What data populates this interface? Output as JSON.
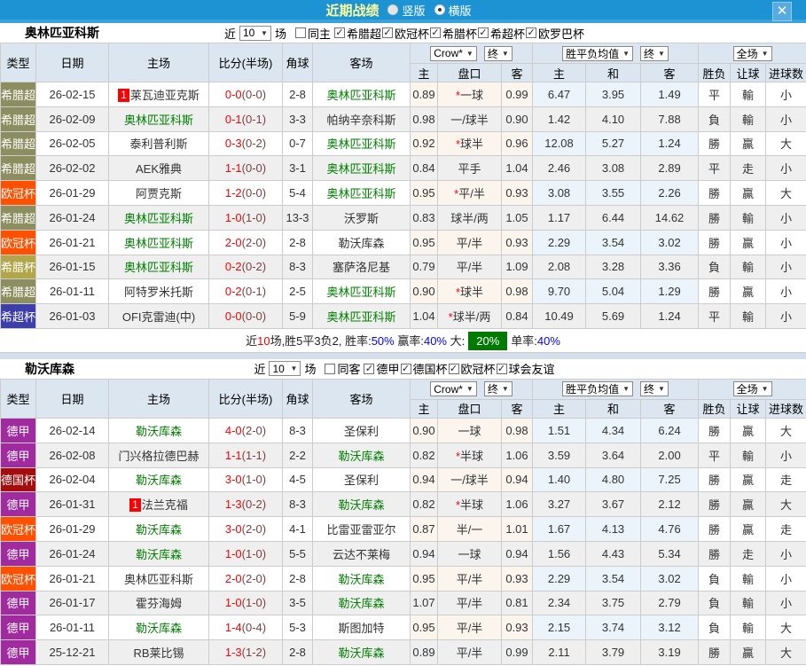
{
  "topbar": {
    "title": "近期战绩",
    "vertical_label": "竖版",
    "horizontal_label": "横版",
    "close_glyph": "✕"
  },
  "filter_labels": {
    "near": "近",
    "games": "场"
  },
  "table_header": {
    "type": "类型",
    "date": "日期",
    "home": "主场",
    "score": "比分(半场)",
    "corner": "角球",
    "away": "客场",
    "company": "Crow*",
    "final": "终",
    "avg": "胜平负均值",
    "full": "全场",
    "h_home": "主",
    "h_handicap": "盘口",
    "h_away": "客",
    "h_draw": "和",
    "h_wdl": "胜负",
    "h_handicap_result": "让球",
    "h_goals": "进球数"
  },
  "type_colors": {
    "希腊超": "#8d8e5f",
    "欧冠杯": "#ff5000",
    "希腊杯": "#b2a64a",
    "希超杯": "#3e3eaa",
    "德甲": "#9f2b9f",
    "德国杯": "#a30d0d"
  },
  "sections": [
    {
      "team": "奥林匹亚科斯",
      "filter": {
        "count": "10",
        "same_label": "同主",
        "same_checked": false,
        "leagues": [
          "希腊超",
          "欧冠杯",
          "希腊杯",
          "希超杯",
          "欧罗巴杯"
        ]
      },
      "rows": [
        {
          "type": "希腊超",
          "date": "26-02-15",
          "badge": "1",
          "home": "莱瓦迪亚克斯",
          "hg": false,
          "score": "0-0",
          "half": "0-0",
          "corner": "2-8",
          "away": "奥林匹亚科斯",
          "ag": true,
          "odds": [
            "0.89",
            "0.99"
          ],
          "star": true,
          "handicap": "一球",
          "avg": [
            "6.47",
            "3.95",
            "1.49"
          ],
          "results": [
            "平",
            "輸",
            "小"
          ]
        },
        {
          "type": "希腊超",
          "date": "26-02-09",
          "badge": "",
          "home": "奥林匹亚科斯",
          "hg": true,
          "score": "0-1",
          "half": "0-1",
          "corner": "3-3",
          "away": "帕纳辛奈科斯",
          "ag": false,
          "odds": [
            "0.98",
            "0.90"
          ],
          "star": false,
          "handicap": "一/球半",
          "avg": [
            "1.42",
            "4.10",
            "7.88"
          ],
          "results": [
            "負",
            "輸",
            "小"
          ]
        },
        {
          "type": "希腊超",
          "date": "26-02-05",
          "badge": "",
          "home": "泰利普利斯",
          "hg": false,
          "score": "0-3",
          "half": "0-2",
          "corner": "0-7",
          "away": "奥林匹亚科斯",
          "ag": true,
          "odds": [
            "0.92",
            "0.96"
          ],
          "star": true,
          "handicap": "球半",
          "avg": [
            "12.08",
            "5.27",
            "1.24"
          ],
          "results": [
            "勝",
            "贏",
            "大"
          ]
        },
        {
          "type": "希腊超",
          "date": "26-02-02",
          "badge": "",
          "home": "AEK雅典",
          "hg": false,
          "score": "1-1",
          "half": "0-0",
          "corner": "3-1",
          "away": "奥林匹亚科斯",
          "ag": true,
          "odds": [
            "0.84",
            "1.04"
          ],
          "star": false,
          "handicap": "平手",
          "avg": [
            "2.46",
            "3.08",
            "2.89"
          ],
          "results": [
            "平",
            "走",
            "小"
          ]
        },
        {
          "type": "欧冠杯",
          "date": "26-01-29",
          "badge": "",
          "home": "阿贾克斯",
          "hg": false,
          "score": "1-2",
          "half": "0-0",
          "corner": "5-4",
          "away": "奥林匹亚科斯",
          "ag": true,
          "odds": [
            "0.95",
            "0.93"
          ],
          "star": true,
          "handicap": "平/半",
          "avg": [
            "3.08",
            "3.55",
            "2.26"
          ],
          "results": [
            "勝",
            "贏",
            "大"
          ]
        },
        {
          "type": "希腊超",
          "date": "26-01-24",
          "badge": "",
          "home": "奥林匹亚科斯",
          "hg": true,
          "score": "1-0",
          "half": "1-0",
          "corner": "13-3",
          "away": "沃罗斯",
          "ag": false,
          "odds": [
            "0.83",
            "1.05"
          ],
          "star": false,
          "handicap": "球半/两",
          "avg": [
            "1.17",
            "6.44",
            "14.62"
          ],
          "results": [
            "勝",
            "輸",
            "小"
          ]
        },
        {
          "type": "欧冠杯",
          "date": "26-01-21",
          "badge": "",
          "home": "奥林匹亚科斯",
          "hg": true,
          "score": "2-0",
          "half": "2-0",
          "corner": "2-8",
          "away": "勒沃库森",
          "ag": false,
          "odds": [
            "0.95",
            "0.93"
          ],
          "star": false,
          "handicap": "平/半",
          "avg": [
            "2.29",
            "3.54",
            "3.02"
          ],
          "results": [
            "勝",
            "贏",
            "小"
          ]
        },
        {
          "type": "希腊杯",
          "date": "26-01-15",
          "badge": "",
          "home": "奥林匹亚科斯",
          "hg": true,
          "score": "0-2",
          "half": "0-2",
          "corner": "8-3",
          "away": "塞萨洛尼基",
          "ag": false,
          "odds": [
            "0.79",
            "1.09"
          ],
          "star": false,
          "handicap": "平/半",
          "avg": [
            "2.08",
            "3.28",
            "3.36"
          ],
          "results": [
            "負",
            "輸",
            "小"
          ]
        },
        {
          "type": "希腊超",
          "date": "26-01-11",
          "badge": "",
          "home": "阿特罗米托斯",
          "hg": false,
          "score": "0-2",
          "half": "0-1",
          "corner": "2-5",
          "away": "奥林匹亚科斯",
          "ag": true,
          "odds": [
            "0.90",
            "0.98"
          ],
          "star": true,
          "handicap": "球半",
          "avg": [
            "9.70",
            "5.04",
            "1.29"
          ],
          "results": [
            "勝",
            "贏",
            "小"
          ]
        },
        {
          "type": "希超杯",
          "date": "26-01-03",
          "badge": "",
          "home": "OFI克雷迪(中)",
          "hg": false,
          "score": "0-0",
          "half": "0-0",
          "corner": "5-9",
          "away": "奥林匹亚科斯",
          "ag": true,
          "odds": [
            "1.04",
            "0.84"
          ],
          "star": true,
          "handicap": "球半/两",
          "avg": [
            "10.49",
            "5.69",
            "1.24"
          ],
          "results": [
            "平",
            "輸",
            "小"
          ]
        }
      ],
      "summary": [
        {
          "t": "近",
          "c": "k"
        },
        {
          "t": "10",
          "c": "r"
        },
        {
          "t": "场,胜5平3负2, 胜率:",
          "c": "k"
        },
        {
          "t": "50%",
          "c": "b"
        },
        {
          "t": " 赢率:",
          "c": "k"
        },
        {
          "t": "40%",
          "c": "b"
        },
        {
          "t": " 大:",
          "c": "k"
        },
        {
          "t": "20%",
          "c": "badge"
        },
        {
          "t": "单率:",
          "c": "k"
        },
        {
          "t": "40%",
          "c": "b"
        }
      ]
    },
    {
      "team": "勒沃库森",
      "filter": {
        "count": "10",
        "same_label": "同客",
        "same_checked": false,
        "leagues": [
          "德甲",
          "德国杯",
          "欧冠杯",
          "球会友谊"
        ]
      },
      "rows": [
        {
          "type": "德甲",
          "date": "26-02-14",
          "badge": "",
          "home": "勒沃库森",
          "hg": true,
          "score": "4-0",
          "half": "2-0",
          "corner": "8-3",
          "away": "圣保利",
          "ag": false,
          "odds": [
            "0.90",
            "0.98"
          ],
          "star": false,
          "handicap": "一球",
          "avg": [
            "1.51",
            "4.34",
            "6.24"
          ],
          "results": [
            "勝",
            "贏",
            "大"
          ]
        },
        {
          "type": "德甲",
          "date": "26-02-08",
          "badge": "",
          "home": "门兴格拉德巴赫",
          "hg": false,
          "score": "1-1",
          "half": "1-1",
          "corner": "2-2",
          "away": "勒沃库森",
          "ag": true,
          "odds": [
            "0.82",
            "1.06"
          ],
          "star": true,
          "handicap": "半球",
          "avg": [
            "3.59",
            "3.64",
            "2.00"
          ],
          "results": [
            "平",
            "輸",
            "小"
          ]
        },
        {
          "type": "德国杯",
          "date": "26-02-04",
          "badge": "",
          "home": "勒沃库森",
          "hg": true,
          "score": "3-0",
          "half": "1-0",
          "corner": "4-5",
          "away": "圣保利",
          "ag": false,
          "odds": [
            "0.94",
            "0.94"
          ],
          "star": false,
          "handicap": "一/球半",
          "avg": [
            "1.40",
            "4.80",
            "7.25"
          ],
          "results": [
            "勝",
            "贏",
            "走"
          ]
        },
        {
          "type": "德甲",
          "date": "26-01-31",
          "badge": "1",
          "home": "法兰克福",
          "hg": false,
          "score": "1-3",
          "half": "0-2",
          "corner": "8-3",
          "away": "勒沃库森",
          "ag": true,
          "odds": [
            "0.82",
            "1.06"
          ],
          "star": true,
          "handicap": "半球",
          "avg": [
            "3.27",
            "3.67",
            "2.12"
          ],
          "results": [
            "勝",
            "贏",
            "大"
          ]
        },
        {
          "type": "欧冠杯",
          "date": "26-01-29",
          "badge": "",
          "home": "勒沃库森",
          "hg": true,
          "score": "3-0",
          "half": "2-0",
          "corner": "4-1",
          "away": "比雷亚雷亚尔",
          "ag": false,
          "odds": [
            "0.87",
            "1.01"
          ],
          "star": false,
          "handicap": "半/一",
          "avg": [
            "1.67",
            "4.13",
            "4.76"
          ],
          "results": [
            "勝",
            "贏",
            "走"
          ]
        },
        {
          "type": "德甲",
          "date": "26-01-24",
          "badge": "",
          "home": "勒沃库森",
          "hg": true,
          "score": "1-0",
          "half": "1-0",
          "corner": "5-5",
          "away": "云达不莱梅",
          "ag": false,
          "odds": [
            "0.94",
            "0.94"
          ],
          "star": false,
          "handicap": "一球",
          "avg": [
            "1.56",
            "4.43",
            "5.34"
          ],
          "results": [
            "勝",
            "走",
            "小"
          ]
        },
        {
          "type": "欧冠杯",
          "date": "26-01-21",
          "badge": "",
          "home": "奥林匹亚科斯",
          "hg": false,
          "score": "2-0",
          "half": "2-0",
          "corner": "2-8",
          "away": "勒沃库森",
          "ag": true,
          "odds": [
            "0.95",
            "0.93"
          ],
          "star": false,
          "handicap": "平/半",
          "avg": [
            "2.29",
            "3.54",
            "3.02"
          ],
          "results": [
            "負",
            "輸",
            "小"
          ]
        },
        {
          "type": "德甲",
          "date": "26-01-17",
          "badge": "",
          "home": "霍芬海姆",
          "hg": false,
          "score": "1-0",
          "half": "1-0",
          "corner": "3-5",
          "away": "勒沃库森",
          "ag": true,
          "odds": [
            "1.07",
            "0.81"
          ],
          "star": false,
          "handicap": "平/半",
          "avg": [
            "2.34",
            "3.75",
            "2.79"
          ],
          "results": [
            "負",
            "輸",
            "小"
          ]
        },
        {
          "type": "德甲",
          "date": "26-01-11",
          "badge": "",
          "home": "勒沃库森",
          "hg": true,
          "score": "1-4",
          "half": "0-4",
          "corner": "5-3",
          "away": "斯图加特",
          "ag": false,
          "odds": [
            "0.95",
            "0.93"
          ],
          "star": false,
          "handicap": "平/半",
          "avg": [
            "2.15",
            "3.74",
            "3.12"
          ],
          "results": [
            "負",
            "輸",
            "大"
          ]
        },
        {
          "type": "德甲",
          "date": "25-12-21",
          "badge": "",
          "home": "RB莱比锡",
          "hg": false,
          "score": "1-3",
          "half": "1-2",
          "corner": "2-8",
          "away": "勒沃库森",
          "ag": true,
          "odds": [
            "0.89",
            "0.99"
          ],
          "star": false,
          "handicap": "平/半",
          "avg": [
            "2.11",
            "3.79",
            "3.19"
          ],
          "results": [
            "勝",
            "贏",
            "大"
          ]
        }
      ],
      "summary": null
    }
  ]
}
